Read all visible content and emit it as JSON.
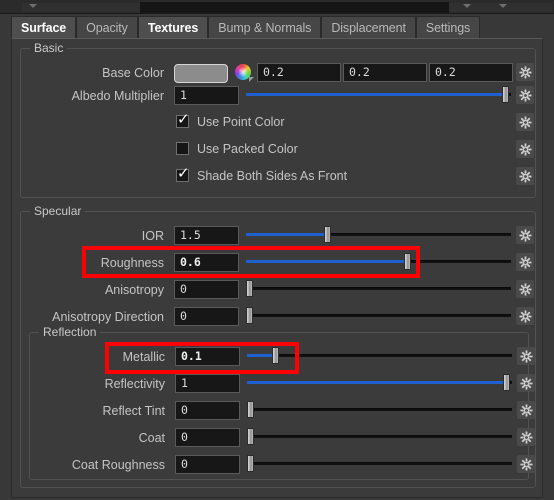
{
  "window": {
    "background": "#383838",
    "panel_bg": "#3b3b3b",
    "accent_slider": "#1f5fd0",
    "highlight_color": "#ff0000"
  },
  "tabs": [
    {
      "label": "Surface",
      "active": true
    },
    {
      "label": "Opacity",
      "active": false
    },
    {
      "label": "Textures",
      "active": true
    },
    {
      "label": "Bump & Normals",
      "active": false
    },
    {
      "label": "Displacement",
      "active": false
    },
    {
      "label": "Settings",
      "active": false
    }
  ],
  "groups": {
    "basic": {
      "title": "Basic"
    },
    "specular": {
      "title": "Specular"
    },
    "reflection": {
      "title": "Reflection"
    }
  },
  "basic": {
    "base_color": {
      "label": "Base Color",
      "swatch_color": "#8c8c8c",
      "r": "0.2",
      "g": "0.2",
      "b": "0.2",
      "color_wheel_icon": "color-wheel-icon",
      "gear_icon": "gear-icon"
    },
    "albedo_multiplier": {
      "label": "Albedo Multiplier",
      "value": "1",
      "slider_percent": 100,
      "gear_icon": "gear-icon"
    },
    "checkboxes": [
      {
        "label": "Use Point Color",
        "checked": true,
        "gear_icon": "gear-icon"
      },
      {
        "label": "Use Packed Color",
        "checked": false,
        "gear_icon": "gear-icon"
      },
      {
        "label": "Shade Both Sides As Front",
        "checked": true,
        "gear_icon": "gear-icon"
      }
    ]
  },
  "specular": {
    "rows": [
      {
        "label": "IOR",
        "value": "1.5",
        "slider_percent": 30,
        "highlighted": false,
        "gear_icon": "gear-icon"
      },
      {
        "label": "Roughness",
        "value": "0.6",
        "slider_percent": 60,
        "highlighted": true,
        "gear_icon": "gear-icon"
      },
      {
        "label": "Anisotropy",
        "value": "0",
        "slider_percent": 0,
        "highlighted": false,
        "gear_icon": "gear-icon"
      },
      {
        "label": "Anisotropy Direction",
        "value": "0",
        "slider_percent": 0,
        "highlighted": false,
        "gear_icon": "gear-icon"
      }
    ]
  },
  "reflection": {
    "rows": [
      {
        "label": "Metallic",
        "value": "0.1",
        "slider_percent": 10,
        "highlighted": true,
        "gear_icon": "gear-icon"
      },
      {
        "label": "Reflectivity",
        "value": "1",
        "slider_percent": 100,
        "highlighted": false,
        "gear_icon": "gear-icon"
      },
      {
        "label": "Reflect Tint",
        "value": "0",
        "slider_percent": 0,
        "highlighted": false,
        "gear_icon": "gear-icon"
      },
      {
        "label": "Coat",
        "value": "0",
        "slider_percent": 0,
        "highlighted": false,
        "gear_icon": "gear-icon"
      },
      {
        "label": "Coat Roughness",
        "value": "0",
        "slider_percent": 0,
        "highlighted": false,
        "gear_icon": "gear-icon"
      }
    ]
  },
  "toolbar_strip": {
    "dropdown_icon": "chevron-down-icon"
  }
}
